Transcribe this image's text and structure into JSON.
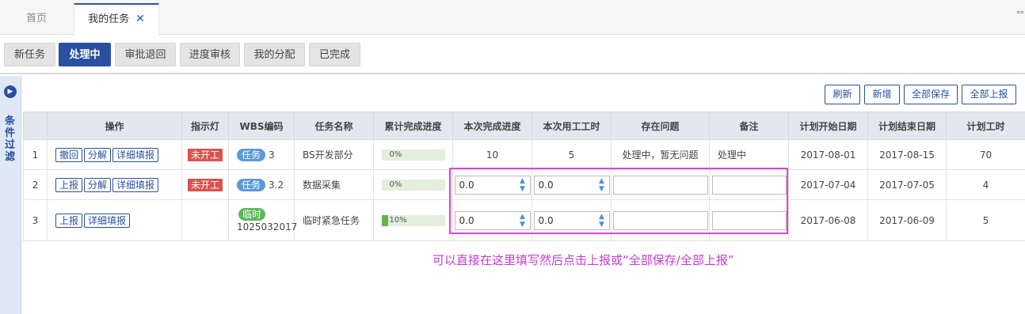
{
  "tabs": {
    "home": "首页",
    "mine": "我的任务",
    "more": "°°"
  },
  "status_buttons": [
    "新任务",
    "处理中",
    "审批退回",
    "进度审核",
    "我的分配",
    "已完成"
  ],
  "active_status": "处理中",
  "sidebar": {
    "label": "条件过滤"
  },
  "actions": {
    "refresh": "刷新",
    "add": "新增",
    "save_all": "全部保存",
    "report_all": "全部上报"
  },
  "table": {
    "headers": [
      "操作",
      "指示灯",
      "WBS编码",
      "任务名称",
      "累计完成进度",
      "本次完成进度",
      "本次用工工时",
      "存在问题",
      "备注",
      "计划开始日期",
      "计划结束日期",
      "计划工时"
    ],
    "rows": [
      {
        "no": "1",
        "ops": [
          "撤回",
          "分解",
          "详细填报"
        ],
        "light": "未开工",
        "wbs_tag": "任务",
        "wbs": "3",
        "name": "BS开发部分",
        "progress": "0%",
        "progress_value": 0,
        "cur_progress": "10",
        "cur_hours": "5",
        "issue": "处理中，暂无问题",
        "remark": "处理中",
        "start": "2017-08-01",
        "end": "2017-08-15",
        "hours": "70"
      },
      {
        "no": "2",
        "ops": [
          "上报",
          "分解",
          "详细填报"
        ],
        "light": "未开工",
        "wbs_tag": "任务",
        "wbs": "3.2",
        "name": "数据采集",
        "progress": "0%",
        "progress_value": 0,
        "cur_progress": "0.0",
        "cur_hours": "0.0",
        "issue": "",
        "remark": "",
        "start": "2017-07-04",
        "end": "2017-07-05",
        "hours": "4"
      },
      {
        "no": "3",
        "ops": [
          "上报",
          "详细填报"
        ],
        "light": "",
        "wbs_tag": "临时",
        "wbs": "1025032017",
        "name": "临时紧急任务",
        "progress": "10%",
        "progress_value": 10,
        "cur_progress": "0.0",
        "cur_hours": "0.0",
        "issue": "",
        "remark": "",
        "start": "2017-06-08",
        "end": "2017-06-09",
        "hours": "5"
      }
    ]
  },
  "annotation": "可以直接在这里填写然后点击上报或“全部保存/全部上报”",
  "colors": {
    "accent": "#2a4f9e",
    "highlight": "#e040e0",
    "annotation": "#c23ccf"
  }
}
